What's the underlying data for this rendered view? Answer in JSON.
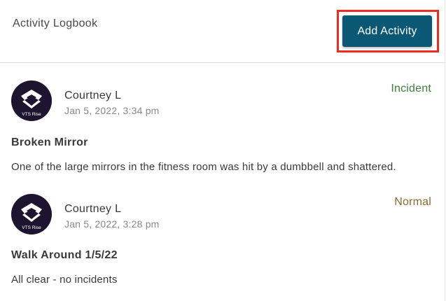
{
  "header": {
    "title": "Activity Logbook",
    "add_button_label": "Add Activity"
  },
  "colors": {
    "primary_button": "#0b5874",
    "highlight": "#ef2b1f",
    "incident": "#3f7d3a",
    "normal": "#8a6a2e",
    "avatar_bg": "#1d1430"
  },
  "entries": [
    {
      "author": "Courtney L",
      "timestamp": "Jan 5, 2022, 3:34 pm",
      "status": "Incident",
      "title": "Broken Mirror",
      "body": "One of the large mirrors in the fitness room was hit by a dumbbell and shattered.",
      "avatar_text": "VTS Rise",
      "avatar_icon": "vts-rise-logo-icon"
    },
    {
      "author": "Courtney L",
      "timestamp": "Jan 5, 2022, 3:28 pm",
      "status": "Normal",
      "title": "Walk Around 1/5/22",
      "body": "All clear - no incidents",
      "avatar_text": "VTS Rise",
      "avatar_icon": "vts-rise-logo-icon"
    }
  ]
}
